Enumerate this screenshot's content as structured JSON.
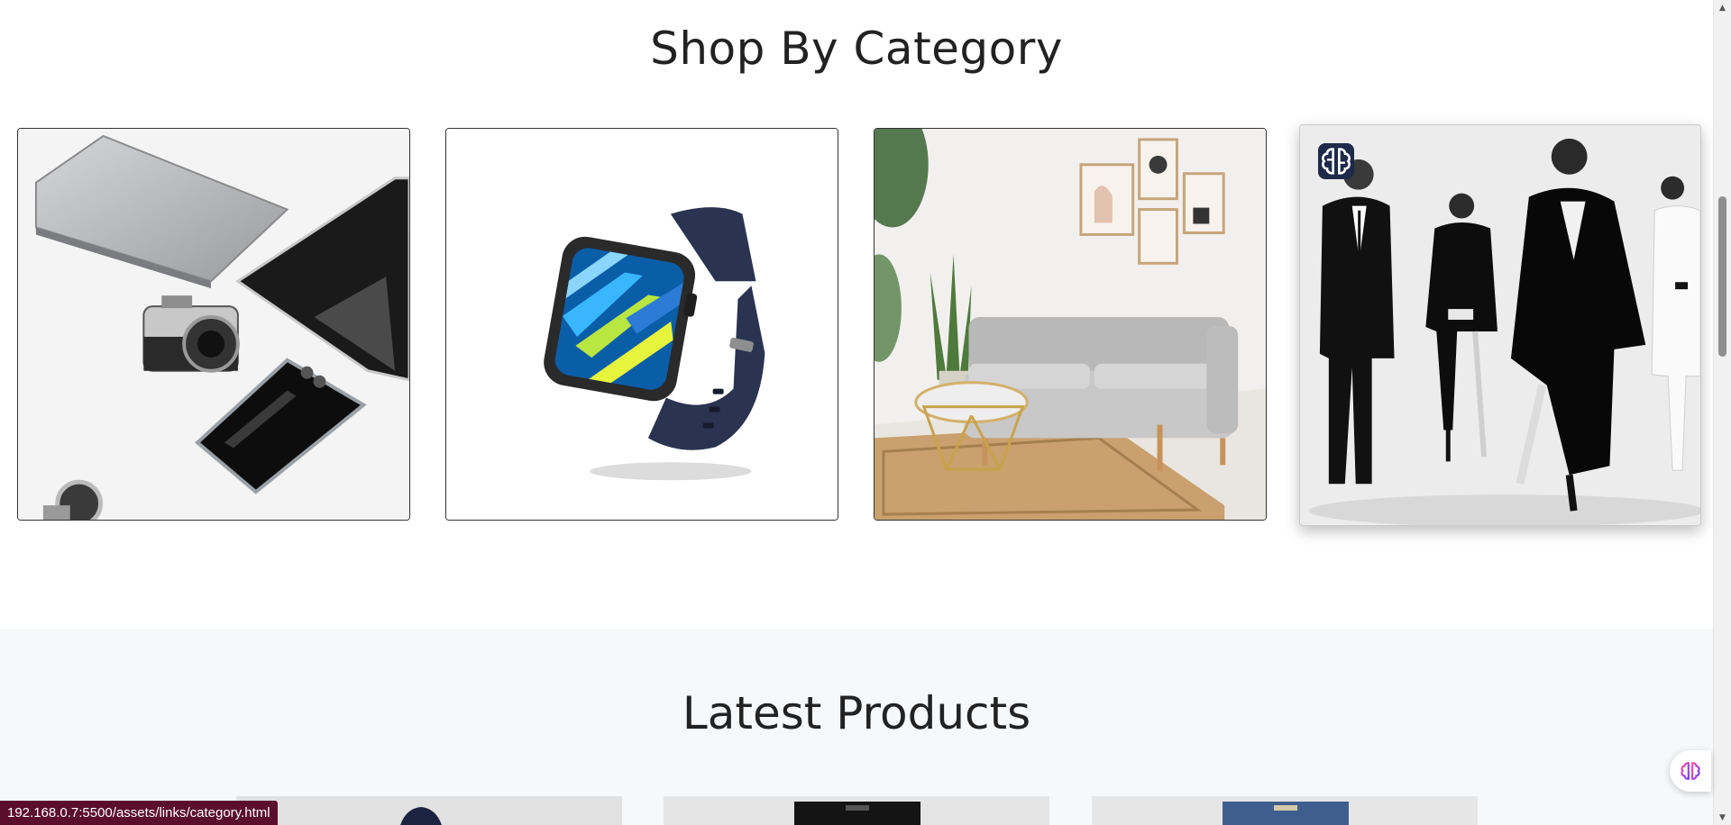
{
  "section_category": {
    "title": "Shop By Category",
    "cards": [
      {
        "name": "category-card-electronics",
        "image": "electronics-devices-image"
      },
      {
        "name": "category-card-smartwatch",
        "image": "smartwatch-image"
      },
      {
        "name": "category-card-furniture",
        "image": "living-room-furniture-image"
      },
      {
        "name": "category-card-fashion",
        "image": "fashion-models-image",
        "badge_icon": "brain-icon"
      }
    ]
  },
  "section_latest": {
    "title": "Latest Products"
  },
  "status_bar": {
    "url": "192.168.0.7:5500/assets/links/category.html"
  },
  "floating_button": {
    "icon": "brain-icon"
  },
  "colors": {
    "text": "#222222",
    "status_bar_bg": "#5b0d2c",
    "badge_bg": "#1e2a4a",
    "latest_bg": "#f7f8fa"
  }
}
